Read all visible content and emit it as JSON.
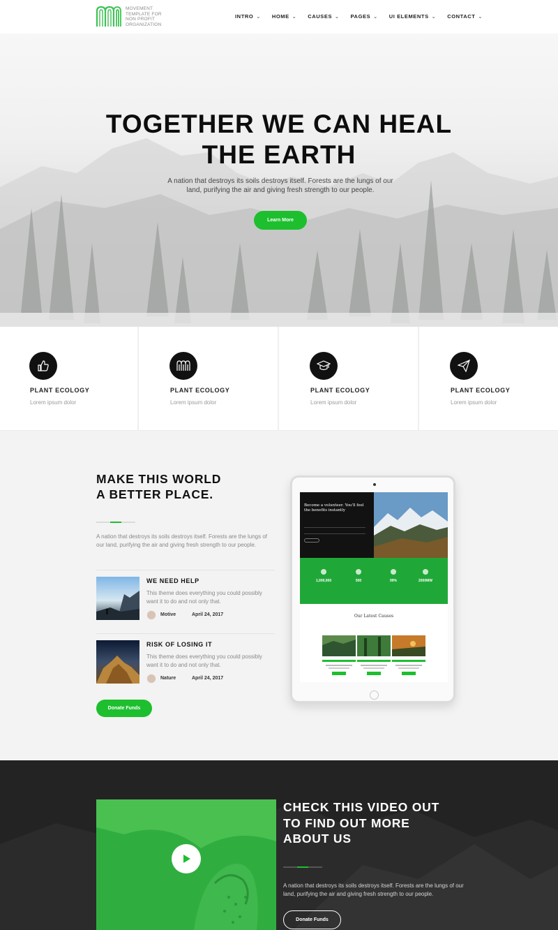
{
  "brand": {
    "logo_text": "MOVEMENT TEMPLATE FOR NON PROFIT ORGANIZATION",
    "accent_color": "#1dbf2e"
  },
  "nav": {
    "items": [
      {
        "label": "INTRO",
        "icon": "chevron-down-icon"
      },
      {
        "label": "HOME",
        "icon": "chevron-down-icon"
      },
      {
        "label": "CAUSES",
        "icon": "chevron-down-icon"
      },
      {
        "label": "PAGES",
        "icon": "chevron-down-icon"
      },
      {
        "label": "UI ELEMENTS",
        "icon": "chevron-down-icon"
      },
      {
        "label": "CONTACT",
        "icon": "chevron-down-icon"
      }
    ]
  },
  "hero": {
    "title_line1": "TOGETHER WE CAN HEAL",
    "title_line2": "THE EARTH",
    "subtitle": "A nation that destroys its soils destroys itself. Forests are the lungs of our land, purifying the air and giving fresh strength to our people.",
    "button_label": "Learn More"
  },
  "features": [
    {
      "icon": "thumbs-up-icon",
      "title": "PLANT ECOLOGY",
      "text": "Lorem ipsum dolor"
    },
    {
      "icon": "logo-m-icon",
      "title": "PLANT ECOLOGY",
      "text": "Lorem ipsum dolor"
    },
    {
      "icon": "graduation-cap-icon",
      "title": "PLANT ECOLOGY",
      "text": "Lorem ipsum dolor"
    },
    {
      "icon": "paper-plane-icon",
      "title": "PLANT ECOLOGY",
      "text": "Lorem ipsum dolor"
    }
  ],
  "world": {
    "title_line1": "MAKE THIS WORLD",
    "title_line2": "A BETTER PLACE.",
    "text": "A nation that destroys its soils destroys itself. Forests are the lungs of our land, purifying the air and giving fresh strength to our people.",
    "posts": [
      {
        "title": "WE NEED HELP",
        "text": "This theme does everything you could possibly want it to do and not only that.",
        "author": "Motive",
        "date": "April 24, 2017"
      },
      {
        "title": "RISK OF LOSING IT",
        "text": "This theme does everything you could possibly want it to do and not only that.",
        "author": "Nature",
        "date": "April 24, 2017"
      }
    ],
    "button_label": "Donate Funds"
  },
  "tablet": {
    "headline": "Become a volunteer. You'll feel the benefits instantly",
    "stats": [
      "1,000,000",
      "500",
      "99%",
      "2000MW"
    ],
    "causes_title": "Our Latest Causes"
  },
  "video": {
    "title_line1": "CHECK THIS VIDEO OUT",
    "title_line2": "TO FIND OUT MORE",
    "title_line3": "ABOUT US",
    "text": "A nation that destroys its soils destroys itself. Forests are the lungs of our land, purifying the air and giving fresh strength to our people.",
    "button_label": "Donate Funds"
  }
}
